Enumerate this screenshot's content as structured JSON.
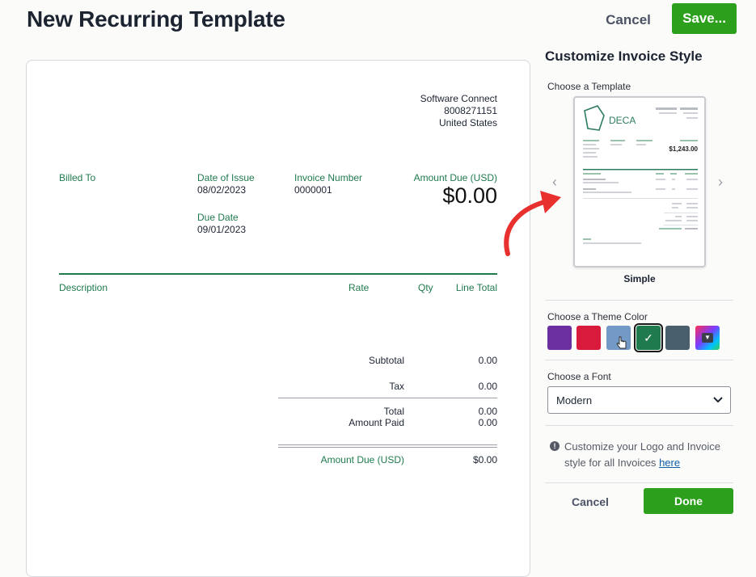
{
  "header": {
    "title": "New Recurring Template",
    "cancel_label": "Cancel",
    "save_label": "Save..."
  },
  "invoice": {
    "company": {
      "name": "Software Connect",
      "phone": "8008271151",
      "country": "United States"
    },
    "billed_to_label": "Billed To",
    "date_of_issue_label": "Date of Issue",
    "date_of_issue": "08/02/2023",
    "due_date_label": "Due Date",
    "due_date": "09/01/2023",
    "invoice_number_label": "Invoice Number",
    "invoice_number": "0000001",
    "amount_due_label": "Amount Due (USD)",
    "amount_due": "$0.00",
    "columns": {
      "description": "Description",
      "rate": "Rate",
      "qty": "Qty",
      "line_total": "Line Total"
    },
    "totals": {
      "subtotal_label": "Subtotal",
      "subtotal": "0.00",
      "tax_label": "Tax",
      "tax": "0.00",
      "total_label": "Total",
      "total": "0.00",
      "amount_paid_label": "Amount Paid",
      "amount_paid": "0.00",
      "amount_due_label": "Amount Due (USD)",
      "amount_due": "$0.00"
    }
  },
  "panel": {
    "title": "Customize Invoice Style",
    "template_label": "Choose a Template",
    "template_name": "Simple",
    "preview": {
      "brand": "DECA",
      "amount": "$1,243.00"
    },
    "theme_label": "Choose a Theme Color",
    "theme_colors": [
      "#6b2fa0",
      "#d81b3c",
      "#7399c6",
      "#1f7a4d",
      "#4a5f6d",
      "gradient"
    ],
    "font_label": "Choose a Font",
    "font_value": "Modern",
    "info_text": "Customize your Logo and Invoice style for all Invoices",
    "info_link": "here",
    "cancel_label": "Cancel",
    "done_label": "Done"
  }
}
